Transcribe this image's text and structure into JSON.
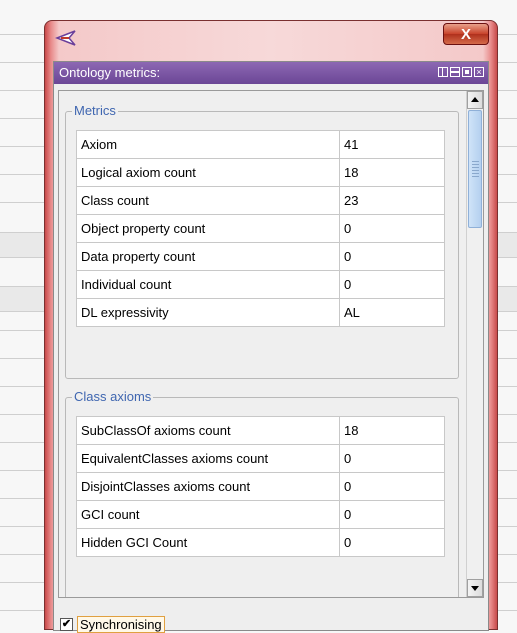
{
  "window": {
    "close_glyph": "X",
    "app_icon": "protege-icon"
  },
  "view": {
    "title": "Ontology metrics:",
    "header_icons": [
      "split-vertical-icon",
      "split-horizontal-icon",
      "float-icon",
      "close-view-icon"
    ]
  },
  "metrics": {
    "title": "Metrics",
    "rows": [
      {
        "name": "Axiom",
        "value": "41"
      },
      {
        "name": "Logical axiom count",
        "value": "18"
      },
      {
        "name": "Class count",
        "value": "23"
      },
      {
        "name": "Object property count",
        "value": "0"
      },
      {
        "name": "Data property count",
        "value": "0"
      },
      {
        "name": "Individual count",
        "value": "0"
      },
      {
        "name": "DL expressivity",
        "value": "AL"
      }
    ]
  },
  "class_axioms": {
    "title": "Class axioms",
    "rows": [
      {
        "name": "SubClassOf axioms count",
        "value": "18"
      },
      {
        "name": "EquivalentClasses axioms count",
        "value": "0"
      },
      {
        "name": "DisjointClasses axioms count",
        "value": "0"
      },
      {
        "name": "GCI count",
        "value": "0"
      },
      {
        "name": "Hidden GCI Count",
        "value": "0"
      }
    ]
  },
  "sync": {
    "checked": true,
    "check_glyph": "✔",
    "label": "Synchronising"
  },
  "scroll": {
    "position_fraction": 0
  }
}
